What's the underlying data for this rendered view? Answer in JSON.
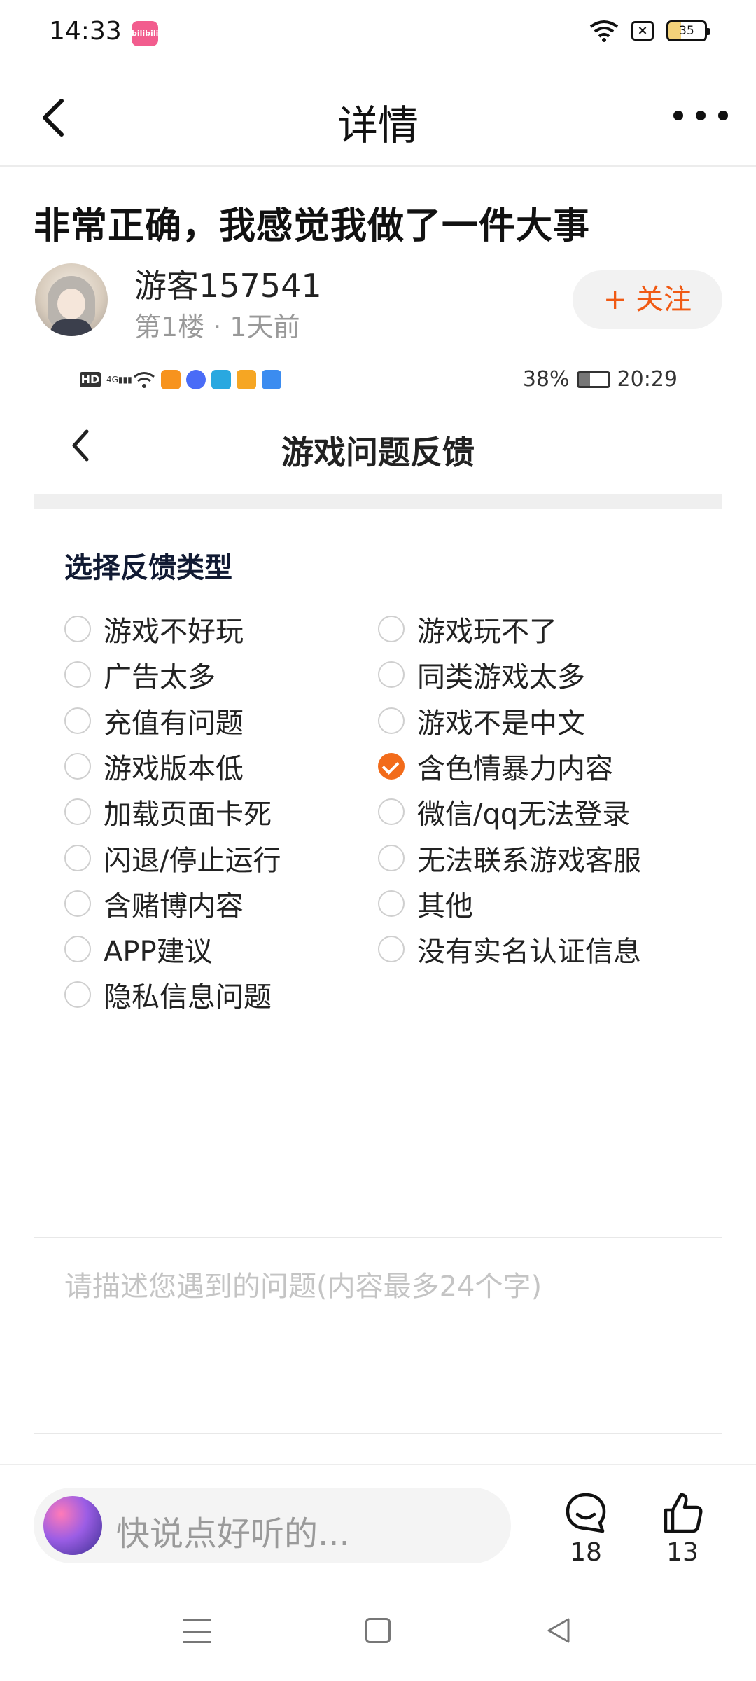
{
  "status_bar": {
    "time": "14:33",
    "app_badge": "bilibili",
    "battery": "35"
  },
  "header": {
    "title": "详情"
  },
  "post": {
    "title": "非常正确，我感觉我做了一件大事",
    "author": "游客157541",
    "meta": "第1楼 · 1天前",
    "follow_label": "+ 关注"
  },
  "screenshot": {
    "status_battery": "38%",
    "status_time": "20:29",
    "page_title": "游戏问题反馈",
    "section_title": "选择反馈类型",
    "options": [
      {
        "label": "游戏不好玩",
        "checked": false
      },
      {
        "label": "游戏玩不了",
        "checked": false
      },
      {
        "label": "广告太多",
        "checked": false
      },
      {
        "label": "同类游戏太多",
        "checked": false
      },
      {
        "label": "充值有问题",
        "checked": false
      },
      {
        "label": "游戏不是中文",
        "checked": false
      },
      {
        "label": "游戏版本低",
        "checked": false
      },
      {
        "label": "含色情暴力内容",
        "checked": true
      },
      {
        "label": "加载页面卡死",
        "checked": false
      },
      {
        "label": "微信/qq无法登录",
        "checked": false
      },
      {
        "label": "闪退/停止运行",
        "checked": false
      },
      {
        "label": "无法联系游戏客服",
        "checked": false
      },
      {
        "label": "含赌博内容",
        "checked": false
      },
      {
        "label": "其他",
        "checked": false
      },
      {
        "label": "APP建议",
        "checked": false
      },
      {
        "label": "没有实名认证信息",
        "checked": false
      },
      {
        "label": "隐私信息问题",
        "checked": false
      }
    ],
    "description_placeholder": "请描述您遇到的问题(内容最多24个字)"
  },
  "bottom_bar": {
    "comment_placeholder": "快说点好听的...",
    "comment_count": "18",
    "like_count": "13"
  },
  "colors": {
    "accent": "#f26b1a",
    "follow_text": "#f05a14"
  }
}
